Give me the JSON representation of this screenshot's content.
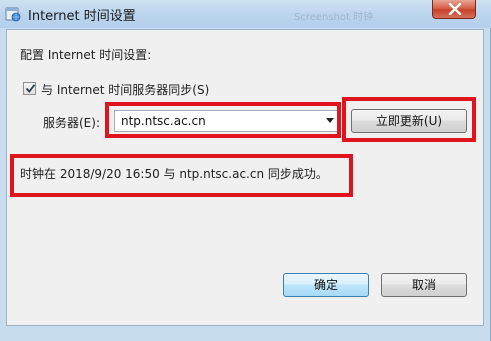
{
  "window": {
    "title": "Internet 时间设置",
    "ghost_title": "Screenshot  时钟"
  },
  "content": {
    "heading": "配置 Internet 时间设置:",
    "sync_checkbox_label": "与 Internet 时间服务器同步(S)",
    "sync_checked": true,
    "server_label": "服务器(E):",
    "server_value": "ntp.ntsc.ac.cn",
    "update_button": "立即更新(U)",
    "status_message": "时钟在 2018/9/20 16:50 与 ntp.ntsc.ac.cn 同步成功。"
  },
  "footer": {
    "ok_button": "确定",
    "cancel_button": "取消"
  },
  "colors": {
    "highlight": "#e0141c",
    "titlebar": "#bcd5ee",
    "client_bg": "#f0f0f0"
  },
  "icons": [
    "clock-globe-icon",
    "close-icon",
    "checkmark-icon",
    "dropdown-arrow-icon"
  ]
}
